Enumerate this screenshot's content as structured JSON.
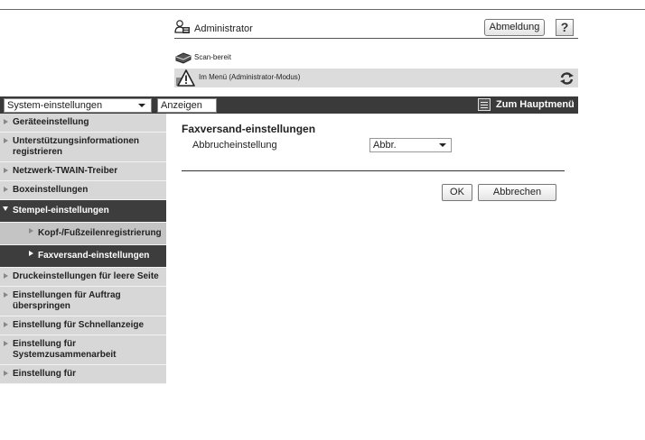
{
  "header": {
    "user": "Administrator",
    "logout_label": "Abmeldung",
    "help_label": "?",
    "status": "Scan-bereit",
    "mode": "Im Menü (Administrator-Modus)"
  },
  "toolbar": {
    "category_select": "System-einstellungen",
    "show_button": "Anzeigen",
    "main_menu": "Zum Hauptmenü"
  },
  "sidebar": {
    "items": [
      {
        "label": "Geräteeinstellung",
        "state": "normal"
      },
      {
        "label": "Unterstützungsinformationen registrieren",
        "state": "normal"
      },
      {
        "label": "Netzwerk-TWAIN-Treiber",
        "state": "normal"
      },
      {
        "label": "Boxeinstellungen",
        "state": "normal"
      },
      {
        "label": "Stempel-einstellungen",
        "state": "expanded"
      },
      {
        "label": "Kopf-/Fußzeilenregistrierung",
        "state": "sub"
      },
      {
        "label": "Faxversand-einstellungen",
        "state": "sub-selected"
      },
      {
        "label": "Druckeinstellungen für leere Seite",
        "state": "normal"
      },
      {
        "label": "Einstellungen für Auftrag überspringen",
        "state": "normal"
      },
      {
        "label": "Einstellung für Schnellanzeige",
        "state": "normal"
      },
      {
        "label": "Einstellung für Systemzusammenarbeit",
        "state": "normal"
      },
      {
        "label": "Einstellung für",
        "state": "normal"
      }
    ]
  },
  "main": {
    "title": "Faxversand-einstellungen",
    "setting_label": "Abbrucheinstellung",
    "setting_value": "Abbr.",
    "ok_label": "OK",
    "cancel_label": "Abbrechen"
  },
  "colors": {
    "toolbar_bg": "#3a3a3a",
    "nav_bg": "#d7d7d7",
    "nav_sub_bg": "#c4c4c4",
    "nav_active_bg": "#3d3d3d",
    "mode_bar_bg": "#dcdcdc"
  }
}
